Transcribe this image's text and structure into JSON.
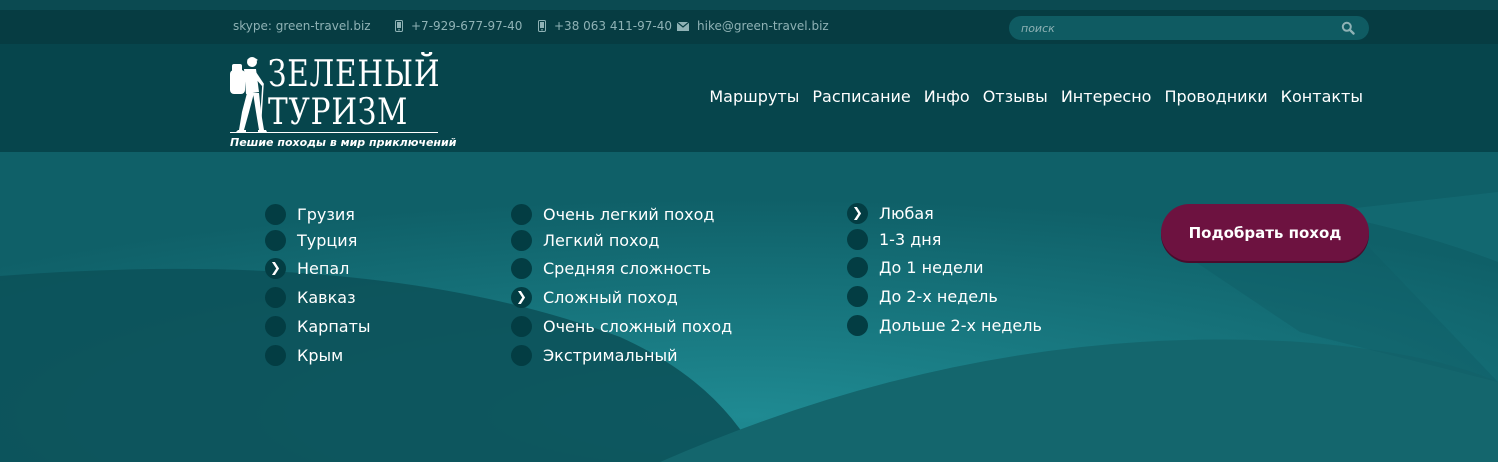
{
  "topbar": {
    "skype": "skype: green-travel.biz",
    "phone1": "+7-929-677-97-40",
    "phone2": "+38 063 411-97-40",
    "email": "hike@green-travel.biz",
    "search_placeholder": "поиск"
  },
  "logo": {
    "line1": "ЗЕЛЕНЫЙ",
    "line2": "ТУРИЗМ",
    "tagline": "Пешие походы в мир приключений"
  },
  "nav": [
    "Маршруты",
    "Расписание",
    "Инфо",
    "Отзывы",
    "Интересно",
    "Проводники",
    "Контакты"
  ],
  "filters": {
    "regions": [
      {
        "label": "Грузия",
        "selected": false
      },
      {
        "label": "Турция",
        "selected": false
      },
      {
        "label": "Непал",
        "selected": true
      },
      {
        "label": "Кавказ",
        "selected": false
      },
      {
        "label": "Карпаты",
        "selected": false
      },
      {
        "label": "Крым",
        "selected": false
      }
    ],
    "difficulty": [
      {
        "label": "Очень легкий поход",
        "selected": false
      },
      {
        "label": "Легкий поход",
        "selected": false
      },
      {
        "label": "Средняя сложность",
        "selected": false
      },
      {
        "label": "Сложный поход",
        "selected": true
      },
      {
        "label": "Очень сложный поход",
        "selected": false
      },
      {
        "label": "Экстримальный",
        "selected": false
      }
    ],
    "duration": [
      {
        "label": "Любая",
        "selected": true
      },
      {
        "label": "1-3 дня",
        "selected": false
      },
      {
        "label": "До 1 недели",
        "selected": false
      },
      {
        "label": "До 2-х недель",
        "selected": false
      },
      {
        "label": "Дольше 2-х недель",
        "selected": false
      }
    ]
  },
  "cta_label": "Подобрать поход",
  "colors": {
    "topbar": "#063c42",
    "header": "#06454c",
    "radio": "#033d43",
    "cta": "#6d1240",
    "hill_dark": "#0a4a52",
    "hill_light": "#1d8088"
  },
  "icons": {
    "phone": "mobile-phone-icon",
    "email": "envelope-icon",
    "search": "magnifier-icon",
    "selected_marker": "chevron-right-icon"
  }
}
